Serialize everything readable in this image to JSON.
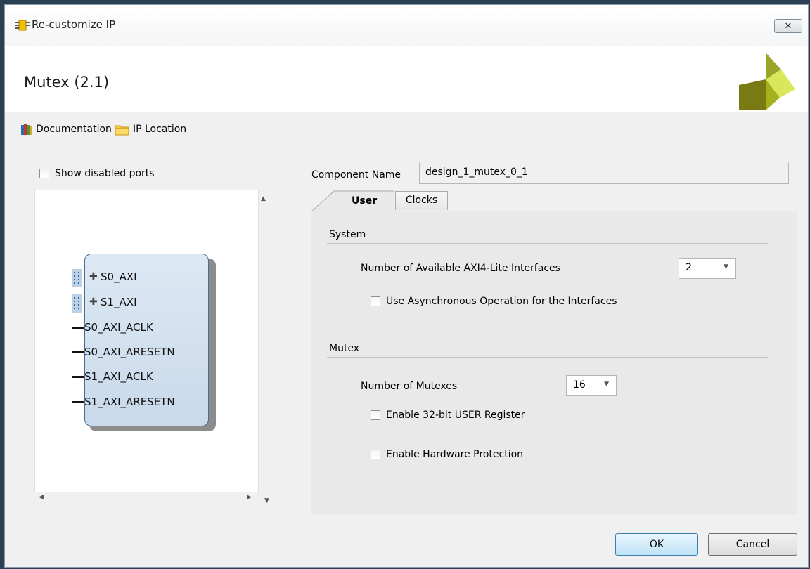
{
  "window": {
    "title": "Re-customize IP",
    "close_glyph": "✕"
  },
  "header": {
    "title": "Mutex (2.1)"
  },
  "links": {
    "documentation": "Documentation",
    "ip_location": "IP Location"
  },
  "left_panel": {
    "show_disabled_ports_label": "Show disabled ports",
    "show_disabled_ports_checked": false,
    "ports": {
      "bus_0": "S0_AXI",
      "bus_1": "S1_AXI",
      "sig_0": "S0_AXI_ACLK",
      "sig_1": "S0_AXI_ARESETN",
      "sig_2": "S1_AXI_ACLK",
      "sig_3": "S1_AXI_ARESETN"
    }
  },
  "right_panel": {
    "component_name_label": "Component Name",
    "component_name_value": "design_1_mutex_0_1",
    "tabs": {
      "user": "User",
      "clocks": "Clocks"
    },
    "active_tab": "User",
    "system": {
      "section_label": "System",
      "num_interfaces_label": "Number of Available AXI4-Lite Interfaces",
      "num_interfaces_value": "2",
      "async_label": "Use Asynchronous Operation for the Interfaces",
      "async_checked": false
    },
    "mutex": {
      "section_label": "Mutex",
      "num_mutexes_label": "Number of Mutexes",
      "num_mutexes_value": "16",
      "user_reg_label": "Enable 32-bit USER Register",
      "user_reg_checked": false,
      "hw_protect_label": "Enable Hardware Protection",
      "hw_protect_checked": false
    }
  },
  "buttons": {
    "ok": "OK",
    "cancel": "Cancel"
  },
  "colors": {
    "logo_dark": "#7a7a14",
    "logo_light": "#d9e85a",
    "ip_block_border": "#4a6d93",
    "ok_button_border": "#3c7fb1"
  }
}
